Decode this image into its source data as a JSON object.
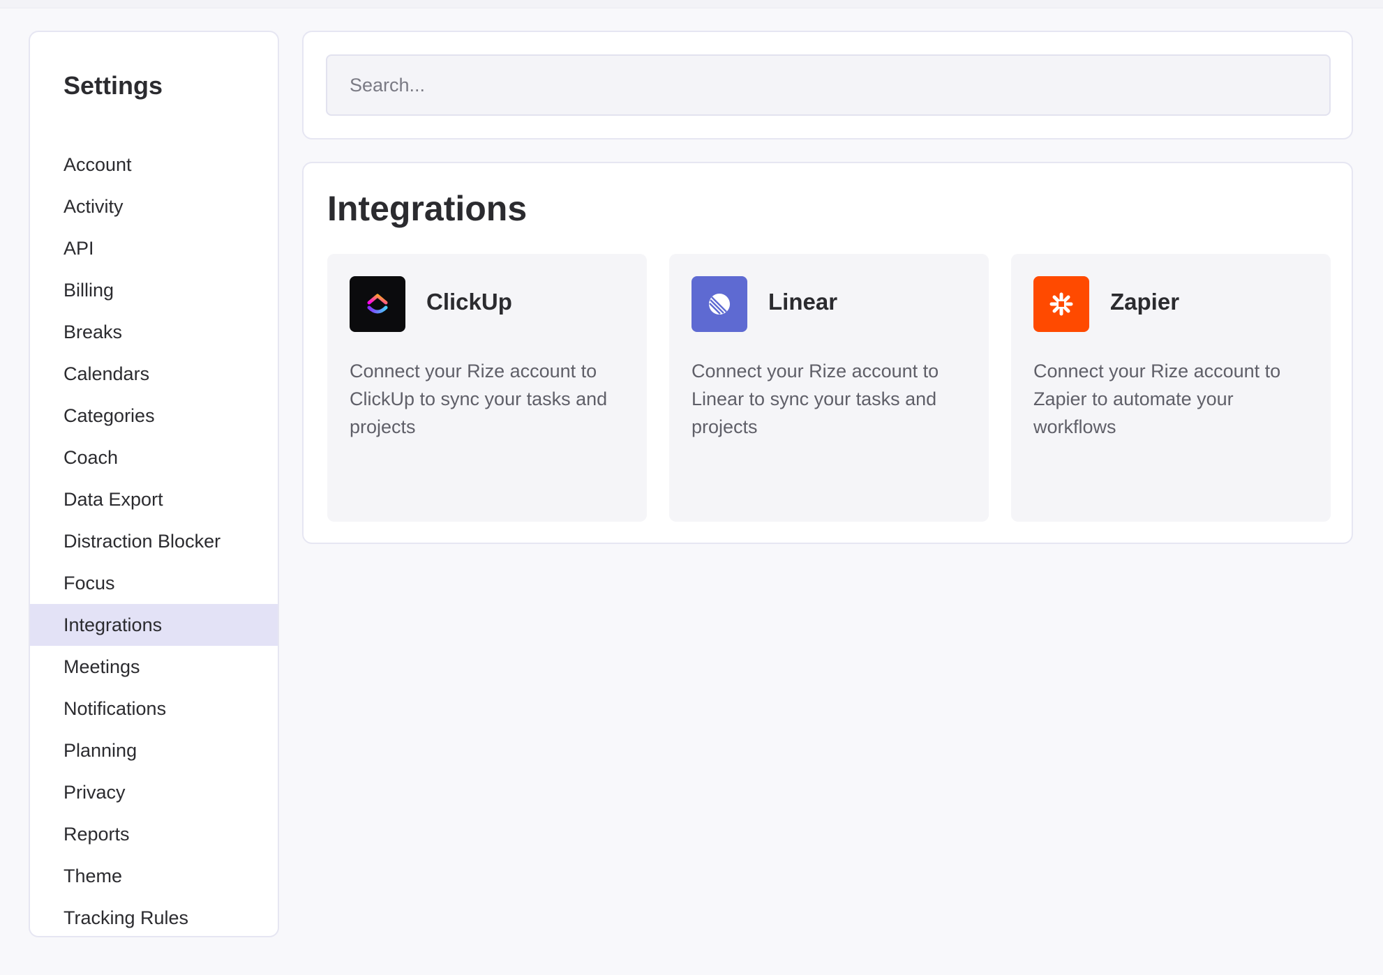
{
  "sidebar": {
    "title": "Settings",
    "items": [
      {
        "label": "Account"
      },
      {
        "label": "Activity"
      },
      {
        "label": "API"
      },
      {
        "label": "Billing"
      },
      {
        "label": "Breaks"
      },
      {
        "label": "Calendars"
      },
      {
        "label": "Categories"
      },
      {
        "label": "Coach"
      },
      {
        "label": "Data Export"
      },
      {
        "label": "Distraction Blocker"
      },
      {
        "label": "Focus"
      },
      {
        "label": "Integrations",
        "active": true
      },
      {
        "label": "Meetings"
      },
      {
        "label": "Notifications"
      },
      {
        "label": "Planning"
      },
      {
        "label": "Privacy"
      },
      {
        "label": "Reports"
      },
      {
        "label": "Theme"
      },
      {
        "label": "Tracking Rules"
      }
    ]
  },
  "search": {
    "placeholder": "Search..."
  },
  "main": {
    "title": "Integrations",
    "integrations": [
      {
        "name": "ClickUp",
        "description": "Connect your Rize account to ClickUp to sync your tasks and projects",
        "icon": "clickup-logo-icon",
        "icon_bg": "#0b0b0d"
      },
      {
        "name": "Linear",
        "description": "Connect your Rize account to Linear to sync your tasks and projects",
        "icon": "linear-logo-icon",
        "icon_bg": "#5e6ad2"
      },
      {
        "name": "Zapier",
        "description": "Connect your Rize account to Zapier to automate your workflows",
        "icon": "zapier-logo-icon",
        "icon_bg": "#ff4a00"
      }
    ]
  },
  "colors": {
    "active_nav_bg": "#e3e2f6",
    "page_bg": "#f8f8fb",
    "tile_bg": "#f5f5f8"
  }
}
